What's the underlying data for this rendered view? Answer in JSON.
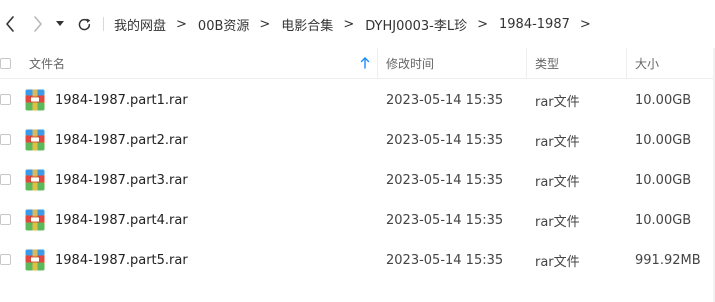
{
  "nav": {
    "back_icon": "chevron-left-icon",
    "forward_icon": "chevron-right-icon",
    "dropdown_icon": "caret-down-icon",
    "refresh_icon": "refresh-icon"
  },
  "breadcrumb": {
    "items": [
      "我的网盘",
      "00B资源",
      "电影合集",
      "DYHJ0003-李L珍",
      "1984-1987"
    ],
    "separator": ">"
  },
  "table": {
    "headers": {
      "name": "文件名",
      "modified": "修改时间",
      "type": "类型",
      "size": "大小"
    },
    "sort_icon": "sort-ascending-arrow-icon",
    "rows": [
      {
        "name": "1984-1987.part1.rar",
        "modified": "2023-05-14 15:35",
        "type": "rar文件",
        "size": "10.00GB",
        "icon": "rar-archive-icon"
      },
      {
        "name": "1984-1987.part2.rar",
        "modified": "2023-05-14 15:35",
        "type": "rar文件",
        "size": "10.00GB",
        "icon": "rar-archive-icon"
      },
      {
        "name": "1984-1987.part3.rar",
        "modified": "2023-05-14 15:35",
        "type": "rar文件",
        "size": "10.00GB",
        "icon": "rar-archive-icon"
      },
      {
        "name": "1984-1987.part4.rar",
        "modified": "2023-05-14 15:35",
        "type": "rar文件",
        "size": "10.00GB",
        "icon": "rar-archive-icon"
      },
      {
        "name": "1984-1987.part5.rar",
        "modified": "2023-05-14 15:35",
        "type": "rar文件",
        "size": "991.92MB",
        "icon": "rar-archive-icon"
      }
    ]
  },
  "colors": {
    "accent": "#1a8cff",
    "divider": "#eeeeee",
    "text": "#333333",
    "header_text": "#666666"
  }
}
